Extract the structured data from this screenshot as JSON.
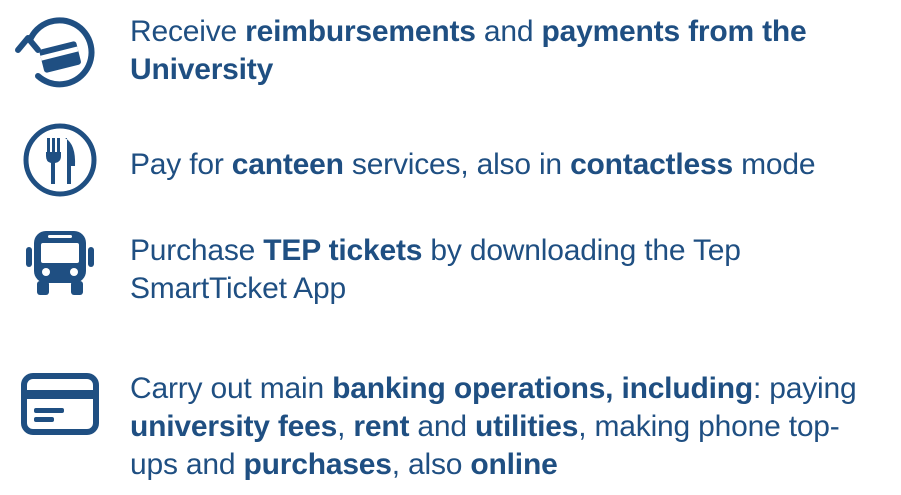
{
  "features": [
    {
      "icon": "card-payment-arrow-icon",
      "parts": [
        {
          "t": "Receive "
        },
        {
          "t": "reimbursements",
          "b": true
        },
        {
          "t": " and "
        },
        {
          "t": "payments from the University",
          "b": true
        }
      ]
    },
    {
      "icon": "fork-knife-icon",
      "parts": [
        {
          "t": "Pay for "
        },
        {
          "t": "canteen",
          "b": true
        },
        {
          "t": " services, also in "
        },
        {
          "t": "contactless",
          "b": true
        },
        {
          "t": " mode"
        }
      ]
    },
    {
      "icon": "bus-icon",
      "parts": [
        {
          "t": "Purchase "
        },
        {
          "t": "TEP tickets",
          "b": true
        },
        {
          "t": " by downloading the Tep SmartTicket App"
        }
      ]
    },
    {
      "icon": "credit-card-icon",
      "parts": [
        {
          "t": "Carry out main "
        },
        {
          "t": "banking operations, including",
          "b": true
        },
        {
          "t": ": paying "
        },
        {
          "t": "university fees",
          "b": true
        },
        {
          "t": ", "
        },
        {
          "t": "rent",
          "b": true
        },
        {
          "t": " and "
        },
        {
          "t": "utilities",
          "b": true
        },
        {
          "t": ", making phone top-ups and "
        },
        {
          "t": "purchases",
          "b": true
        },
        {
          "t": ", also "
        },
        {
          "t": "online",
          "b": true
        }
      ]
    }
  ],
  "colors": {
    "text": "#1f4f82",
    "icon": "#1f4f82",
    "background": "#ffffff"
  }
}
